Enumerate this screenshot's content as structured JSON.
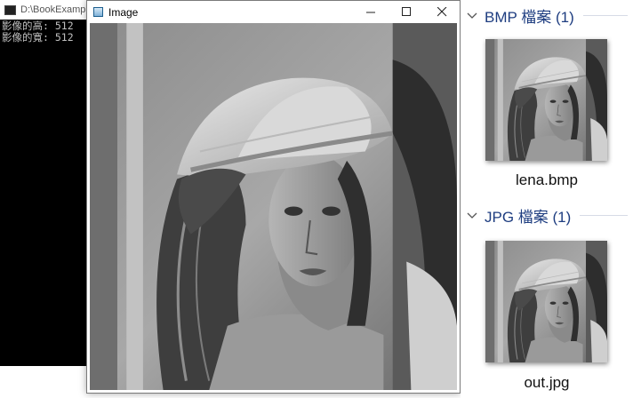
{
  "console": {
    "title": "D:\\BookExampleV",
    "lines": [
      "影像的高: 512",
      "影像的寬: 512"
    ]
  },
  "image_window": {
    "title": "Image",
    "buttons": [
      "minimize",
      "maximize",
      "close"
    ]
  },
  "explorer": {
    "groups": [
      {
        "header": "BMP 檔案 (1)",
        "file": "lena.bmp"
      },
      {
        "header": "JPG 檔案 (1)",
        "file": "out.jpg"
      }
    ]
  },
  "colors": {
    "group_header": "#1e3d80",
    "console_bg": "#000000",
    "console_text": "#c0c0c0"
  },
  "icons": [
    "console-app-icon",
    "image-app-icon",
    "minimize-icon",
    "maximize-icon",
    "close-icon",
    "chevron-down-icon"
  ]
}
